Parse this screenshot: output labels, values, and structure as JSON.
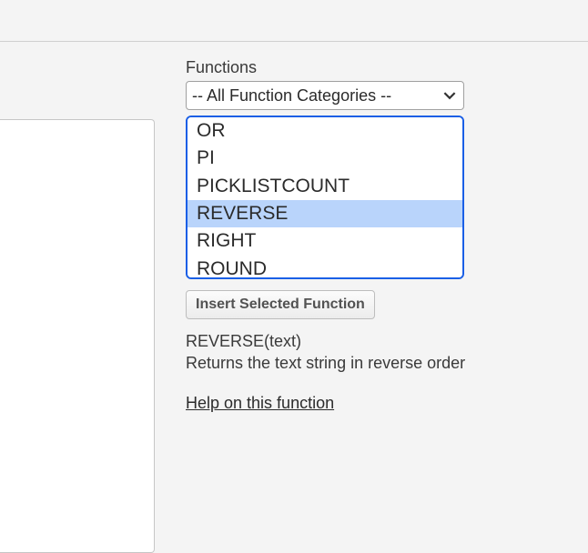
{
  "section_label": "Functions",
  "category_dropdown": {
    "selected": "-- All Function Categories --"
  },
  "function_list": {
    "items": [
      {
        "name": "OR",
        "selected": false
      },
      {
        "name": "PI",
        "selected": false
      },
      {
        "name": "PICKLISTCOUNT",
        "selected": false
      },
      {
        "name": "REVERSE",
        "selected": true
      },
      {
        "name": "RIGHT",
        "selected": false
      },
      {
        "name": "ROUND",
        "selected": false
      }
    ]
  },
  "insert_button_label": "Insert Selected Function",
  "selected_function": {
    "signature": "REVERSE(text)",
    "description": "Returns the text string in reverse order"
  },
  "help_link_label": "Help on this function"
}
